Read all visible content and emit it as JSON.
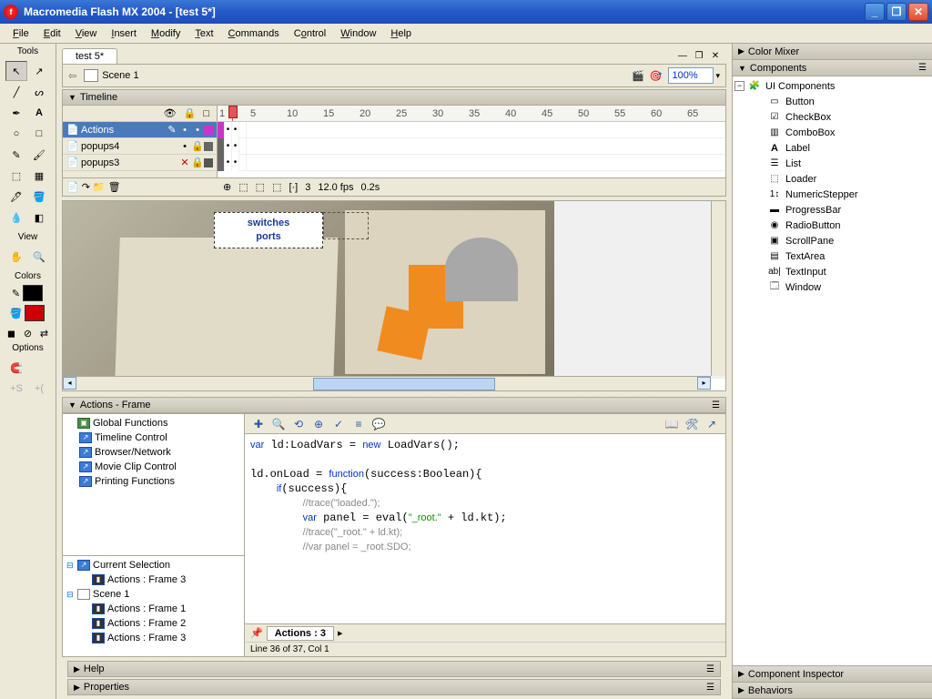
{
  "window": {
    "title": "Macromedia Flash MX 2004 - [test 5*]"
  },
  "menu": [
    "File",
    "Edit",
    "View",
    "Insert",
    "Modify",
    "Text",
    "Commands",
    "Control",
    "Window",
    "Help"
  ],
  "tools_label": "Tools",
  "view_label": "View",
  "colors_label": "Colors",
  "options_label": "Options",
  "doc_tab": "test 5*",
  "scene": {
    "name": "Scene 1",
    "zoom": "100%"
  },
  "timeline": {
    "title": "Timeline",
    "layers": [
      {
        "name": "Actions",
        "selected": true
      },
      {
        "name": "popups4",
        "selected": false
      },
      {
        "name": "popups3",
        "selected": false
      }
    ],
    "frame_num": "3",
    "fps": "12.0 fps",
    "time": "0.2s",
    "ruler_marks": [
      "1",
      "5",
      "10",
      "15",
      "20",
      "25",
      "30",
      "35",
      "40",
      "45",
      "50",
      "55",
      "60",
      "65"
    ]
  },
  "stage": {
    "switches_line1": "switches",
    "switches_line2": "ports"
  },
  "actions": {
    "title": "Actions - Frame",
    "global_functions": "Global Functions",
    "categories": [
      "Timeline Control",
      "Browser/Network",
      "Movie Clip Control",
      "Printing Functions"
    ],
    "current_selection": "Current Selection",
    "sel_item": "Actions : Frame 3",
    "scene1": "Scene 1",
    "scene_items": [
      "Actions : Frame 1",
      "Actions : Frame 2",
      "Actions : Frame 3"
    ],
    "code_lines": [
      "var ld:LoadVars = new LoadVars();",
      "",
      "ld.onLoad = function(success:Boolean){",
      "    if(success){",
      "        //trace(\"loaded.\");",
      "        var panel = eval(\"_root.\" + ld.kt);",
      "        //trace(\"_root.\" + ld.kt);",
      "        //var panel = _root.SDO;"
    ],
    "tab_label": "Actions : 3",
    "status": "Line 36 of 37, Col 1"
  },
  "bottom": {
    "help": "Help",
    "properties": "Properties"
  },
  "right": {
    "color_mixer": "Color Mixer",
    "components": "Components",
    "ui_components": "UI Components",
    "items": [
      "Button",
      "CheckBox",
      "ComboBox",
      "Label",
      "List",
      "Loader",
      "NumericStepper",
      "ProgressBar",
      "RadioButton",
      "ScrollPane",
      "TextArea",
      "TextInput",
      "Window"
    ],
    "comp_inspector": "Component Inspector",
    "behaviors": "Behaviors"
  }
}
